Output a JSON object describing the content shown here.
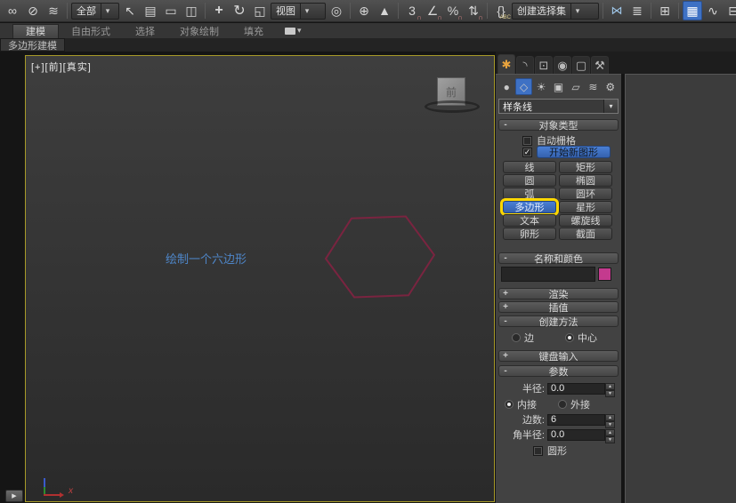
{
  "colors": {
    "accent_blue": "#3e71c4",
    "highlight_yellow": "#ffd800",
    "viewport_border_yellow": "#a79a28",
    "hexagon_stroke": "#7a2440",
    "annotation_blue": "#4e86c9",
    "object_color_swatch": "#c43a8e"
  },
  "icons": {
    "link": "∞",
    "unlink": "⊘",
    "bind_spacewarp": "≋",
    "cursor": "↖",
    "by_name": "▤",
    "region": "▭",
    "window_crossing": "◫",
    "move": "+",
    "rotate": "↻",
    "scale": "◱",
    "center": "◎",
    "manipulate": "⊕",
    "kbd_override": "▲",
    "snap3": "3",
    "angle": "∠",
    "percent": "%",
    "spinner": "⇅",
    "magnet": "∩",
    "braces": "{}",
    "abc": "ABC",
    "mirror": "⋈",
    "align": "≣",
    "layers": "⊞",
    "ribbon_toggle": "▦",
    "curve": "∿",
    "schematic": "⊟",
    "drop_arrow": "▾",
    "create": "✱",
    "modify": "◝",
    "hierarchy": "⊡",
    "motion": "◉",
    "display": "▢",
    "utilities": "⚒",
    "geometry": "●",
    "shapes": "◇",
    "lights": "☀",
    "cameras": "▣",
    "helpers": "▱",
    "systems": "⚙",
    "flyout": "▶",
    "check": "✓",
    "expanded": "-",
    "collapsed": "+"
  },
  "toolbar": {
    "selection_filter": "全部",
    "reference_coordinate_system": "视图",
    "named_selection_set": "创建选择集"
  },
  "ribbon": {
    "tabs": [
      {
        "label": "建模"
      },
      {
        "label": "自由形式"
      },
      {
        "label": "选择"
      },
      {
        "label": "对象绘制"
      },
      {
        "label": "填充"
      }
    ],
    "panel_tab": "多边形建模"
  },
  "viewport": {
    "label": "[+][前][真实]",
    "annotation": "绘制一个六边形",
    "viewcube_label": "前",
    "axis_x_label": "x"
  },
  "panel": {
    "category_dropdown": "样条线",
    "object_type": {
      "title": "对象类型",
      "autogrid_label": "自动栅格",
      "start_new_shape_label": "开始新图形",
      "rows": [
        [
          "线",
          "矩形"
        ],
        [
          "圆",
          "椭圆"
        ],
        [
          "弧",
          "圆环"
        ],
        [
          "多边形",
          "星形"
        ],
        [
          "文本",
          "螺旋线"
        ],
        [
          "卵形",
          "截面"
        ]
      ],
      "active_button": "多边形"
    },
    "name_color": {
      "title": "名称和颜色",
      "name_value": ""
    },
    "rollouts": {
      "render": "渲染",
      "interpolation": "插值",
      "creation_method": "创建方法",
      "keyboard_entry": "键盘输入",
      "parameters": "参数"
    },
    "creation_method": {
      "edge": "边",
      "center": "中心",
      "selected": "中心"
    },
    "parameters": {
      "radius_label": "半径:",
      "radius": "0.0",
      "inscribed": "内接",
      "circumscribed": "外接",
      "selected_mode": "内接",
      "sides_label": "边数:",
      "sides": "6",
      "corner_radius_label": "角半径:",
      "corner_radius": "0.0",
      "circular_label": "圆形"
    }
  }
}
